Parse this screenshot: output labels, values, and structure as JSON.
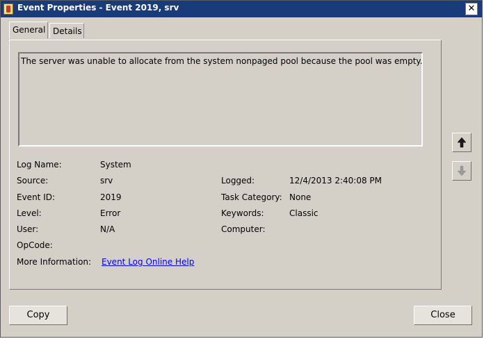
{
  "window": {
    "title": "Event Properties - Event 2019, srv",
    "close_glyph": "✕"
  },
  "tabs": [
    {
      "label": "General",
      "selected": true
    },
    {
      "label": "Details",
      "selected": false
    }
  ],
  "general": {
    "description": "The server was unable to allocate from the system nonpaged pool because the pool was empty.",
    "fields": {
      "log_name": {
        "label": "Log Name:",
        "value": "System"
      },
      "source": {
        "label": "Source:",
        "value": "srv"
      },
      "logged": {
        "label": "Logged:",
        "value": "12/4/2013 2:40:08 PM"
      },
      "event_id": {
        "label": "Event ID:",
        "value": "2019"
      },
      "task_category": {
        "label": "Task Category:",
        "value": "None"
      },
      "level": {
        "label": "Level:",
        "value": "Error"
      },
      "keywords": {
        "label": "Keywords:",
        "value": "Classic"
      },
      "user": {
        "label": "User:",
        "value": "N/A"
      },
      "computer": {
        "label": "Computer:",
        "value": ""
      },
      "opcode": {
        "label": "OpCode:",
        "value": ""
      },
      "more_information": {
        "label": "More Information:",
        "link_text": "Event Log Online Help"
      }
    }
  },
  "buttons": {
    "copy": "Copy",
    "close": "Close"
  },
  "icons": {
    "prev_event": "arrow-up-icon",
    "next_event": "arrow-down-icon"
  },
  "colors": {
    "titlebar": "#1a3b7a",
    "dialog_bg": "#d4d0c8",
    "link": "#0000ee"
  }
}
